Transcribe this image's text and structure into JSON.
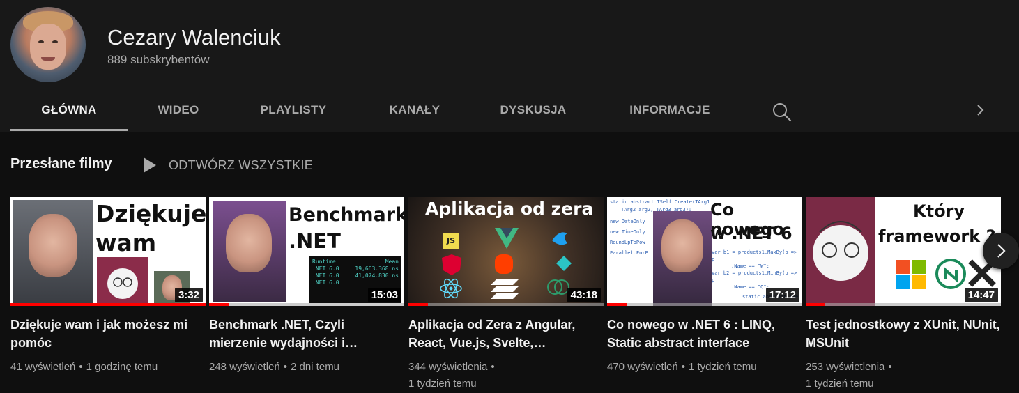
{
  "channel": {
    "name": "Cezary Walenciuk",
    "subscribers": "889 subskrybentów"
  },
  "tabs": [
    {
      "label": "GŁÓWNA",
      "active": true
    },
    {
      "label": "WIDEO",
      "active": false
    },
    {
      "label": "PLAYLISTY",
      "active": false
    },
    {
      "label": "KANAŁY",
      "active": false
    },
    {
      "label": "DYSKUSJA",
      "active": false
    },
    {
      "label": "INFORMACJE",
      "active": false
    }
  ],
  "section": {
    "title": "Przesłane filmy",
    "play_all_label": "ODTWÓRZ WSZYSTKIE"
  },
  "videos": [
    {
      "thumb_text_1": "Dziękuje",
      "thumb_text_2": "wam",
      "duration": "3:32",
      "progress_pct": 100,
      "title": "Dziękuje wam i jak możesz mi pomóc",
      "views": "41 wyświetleń",
      "age": "1 godzinę temu"
    },
    {
      "thumb_text_1": "Benchmark",
      "thumb_text_2": ".NET",
      "table_header_1": "Runtime",
      "table_header_2": "Mean",
      "table_row_1a": ".NET 6.0",
      "table_row_1b": "19,663.368 ns",
      "table_row_2a": ".NET 6.0",
      "table_row_2b": "41,074.830 ns",
      "table_row_3a": ".NET 6.0",
      "duration": "15:03",
      "progress_pct": 10,
      "title": "Benchmark .NET, Czyli mierzenie wydajności i…",
      "views": "248 wyświetleń",
      "age": "2 dni temu"
    },
    {
      "thumb_text_1": "Aplikacja od zera",
      "badge_js": "JS",
      "duration": "43:18",
      "progress_pct": 10,
      "title": "Aplikacja od Zera z Angular, React, Vue.js, Svelte,…",
      "views": "344 wyświetlenia",
      "age": "1 tydzień temu"
    },
    {
      "thumb_text_1": "Co nowego",
      "thumb_text_2": "w .NET 6",
      "code_1": "static abstract TSelf Create(TArg1",
      "code_2": "TArg2 arg2, TArg3 arg3);",
      "code_3": "new DateOnly",
      "code_4": "new TimeOnly",
      "code_5": "RoundUpToPow",
      "code_6": "Parallel.ForE",
      "code_7": "var b1 = products1.MaxBy(p => p",
      "code_8": ".Name == \"W\";",
      "code_9": "var b2 = products1.MinBy(p => p",
      "code_10": ".Name == \"Q\";",
      "code_11": "static abstract TSe",
      "duration": "17:12",
      "progress_pct": 10,
      "title": "Co nowego w .NET 6 : LINQ, Static abstract interface",
      "views": "470 wyświetleń",
      "age": "1 tydzień temu"
    },
    {
      "thumb_text_1": "Który",
      "thumb_text_2": "framework ?",
      "duration": "14:47",
      "progress_pct": 10,
      "title": "Test jednostkowy z XUnit, NUnit, MSUnit",
      "views": "253 wyświetlenia",
      "age": "1 tydzień temu"
    }
  ],
  "colors": {
    "background": "#0f0f0f",
    "header_bg": "#181818",
    "progress": "#ff0000",
    "muted_text": "#aaaaaa"
  },
  "icons": {
    "tabs_search": "search-icon",
    "tabs_next": "chevron-right-icon",
    "play_all": "play-icon",
    "carousel_next": "chevron-right-icon"
  }
}
